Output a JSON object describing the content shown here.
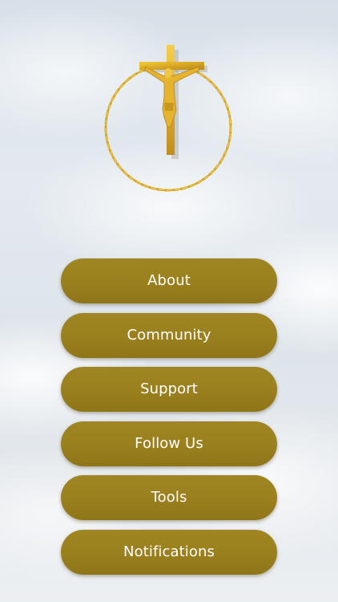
{
  "menu": {
    "items": [
      {
        "label": "About"
      },
      {
        "label": "Community"
      },
      {
        "label": "Support"
      },
      {
        "label": "Follow Us"
      },
      {
        "label": "Tools"
      },
      {
        "label": "Notifications"
      }
    ]
  },
  "theme": {
    "button_color": "#9a7f1e",
    "button_text_color": "#ffffff",
    "emblem_gold": "#d9a823"
  },
  "icons": {
    "emblem": "crucifix-rosary-icon"
  }
}
